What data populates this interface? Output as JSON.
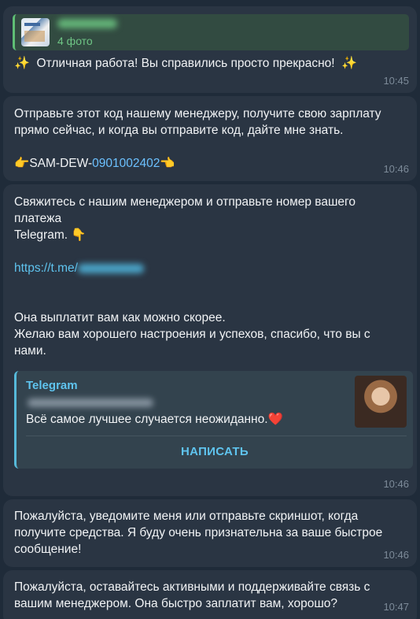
{
  "messages": [
    {
      "reply": {
        "subtitle": "4 фото"
      },
      "text": "Отличная работа! Вы справились просто прекрасно!",
      "emoji_left": "✨",
      "emoji_right": "✨",
      "time": "10:45"
    },
    {
      "lines": [
        "Отправьте этот код нашему менеджеру, получите свою зарплату",
        "прямо сейчас, и когда вы отправите код, дайте мне знать."
      ],
      "code_prefix": "SAM-DEW-",
      "code_number": "0901002402",
      "emoji_before": "👉",
      "emoji_after": "👈",
      "time": "10:46"
    },
    {
      "lines": [
        "Свяжитесь с нашим менеджером и отправьте номер вашего",
        "платежа",
        "Telegram."
      ],
      "emoji_after_telegram": "👇",
      "link": "https://t.me/",
      "closing_lines": [
        "Она выплатит вам как можно скорее.",
        "Желаю вам хорошего настроения и успехов, спасибо, что вы с",
        "нами."
      ],
      "preview": {
        "site": "Telegram",
        "description": "Всё самое лучшее случается неожиданно.",
        "emoji": "❤️",
        "button": "НАПИСАТЬ"
      },
      "time": "10:46"
    },
    {
      "lines": [
        "Пожалуйста, уведомите меня или отправьте скриншот, когда",
        "получите средства. Я буду очень признательна за ваше быстрое",
        "сообщение!"
      ],
      "time": "10:46"
    },
    {
      "lines": [
        "Пожалуйста, оставайтесь активными и поддерживайте связь с",
        "вашим менеджером. Она быстро заплатит вам, хорошо?"
      ],
      "time": "10:47"
    }
  ]
}
